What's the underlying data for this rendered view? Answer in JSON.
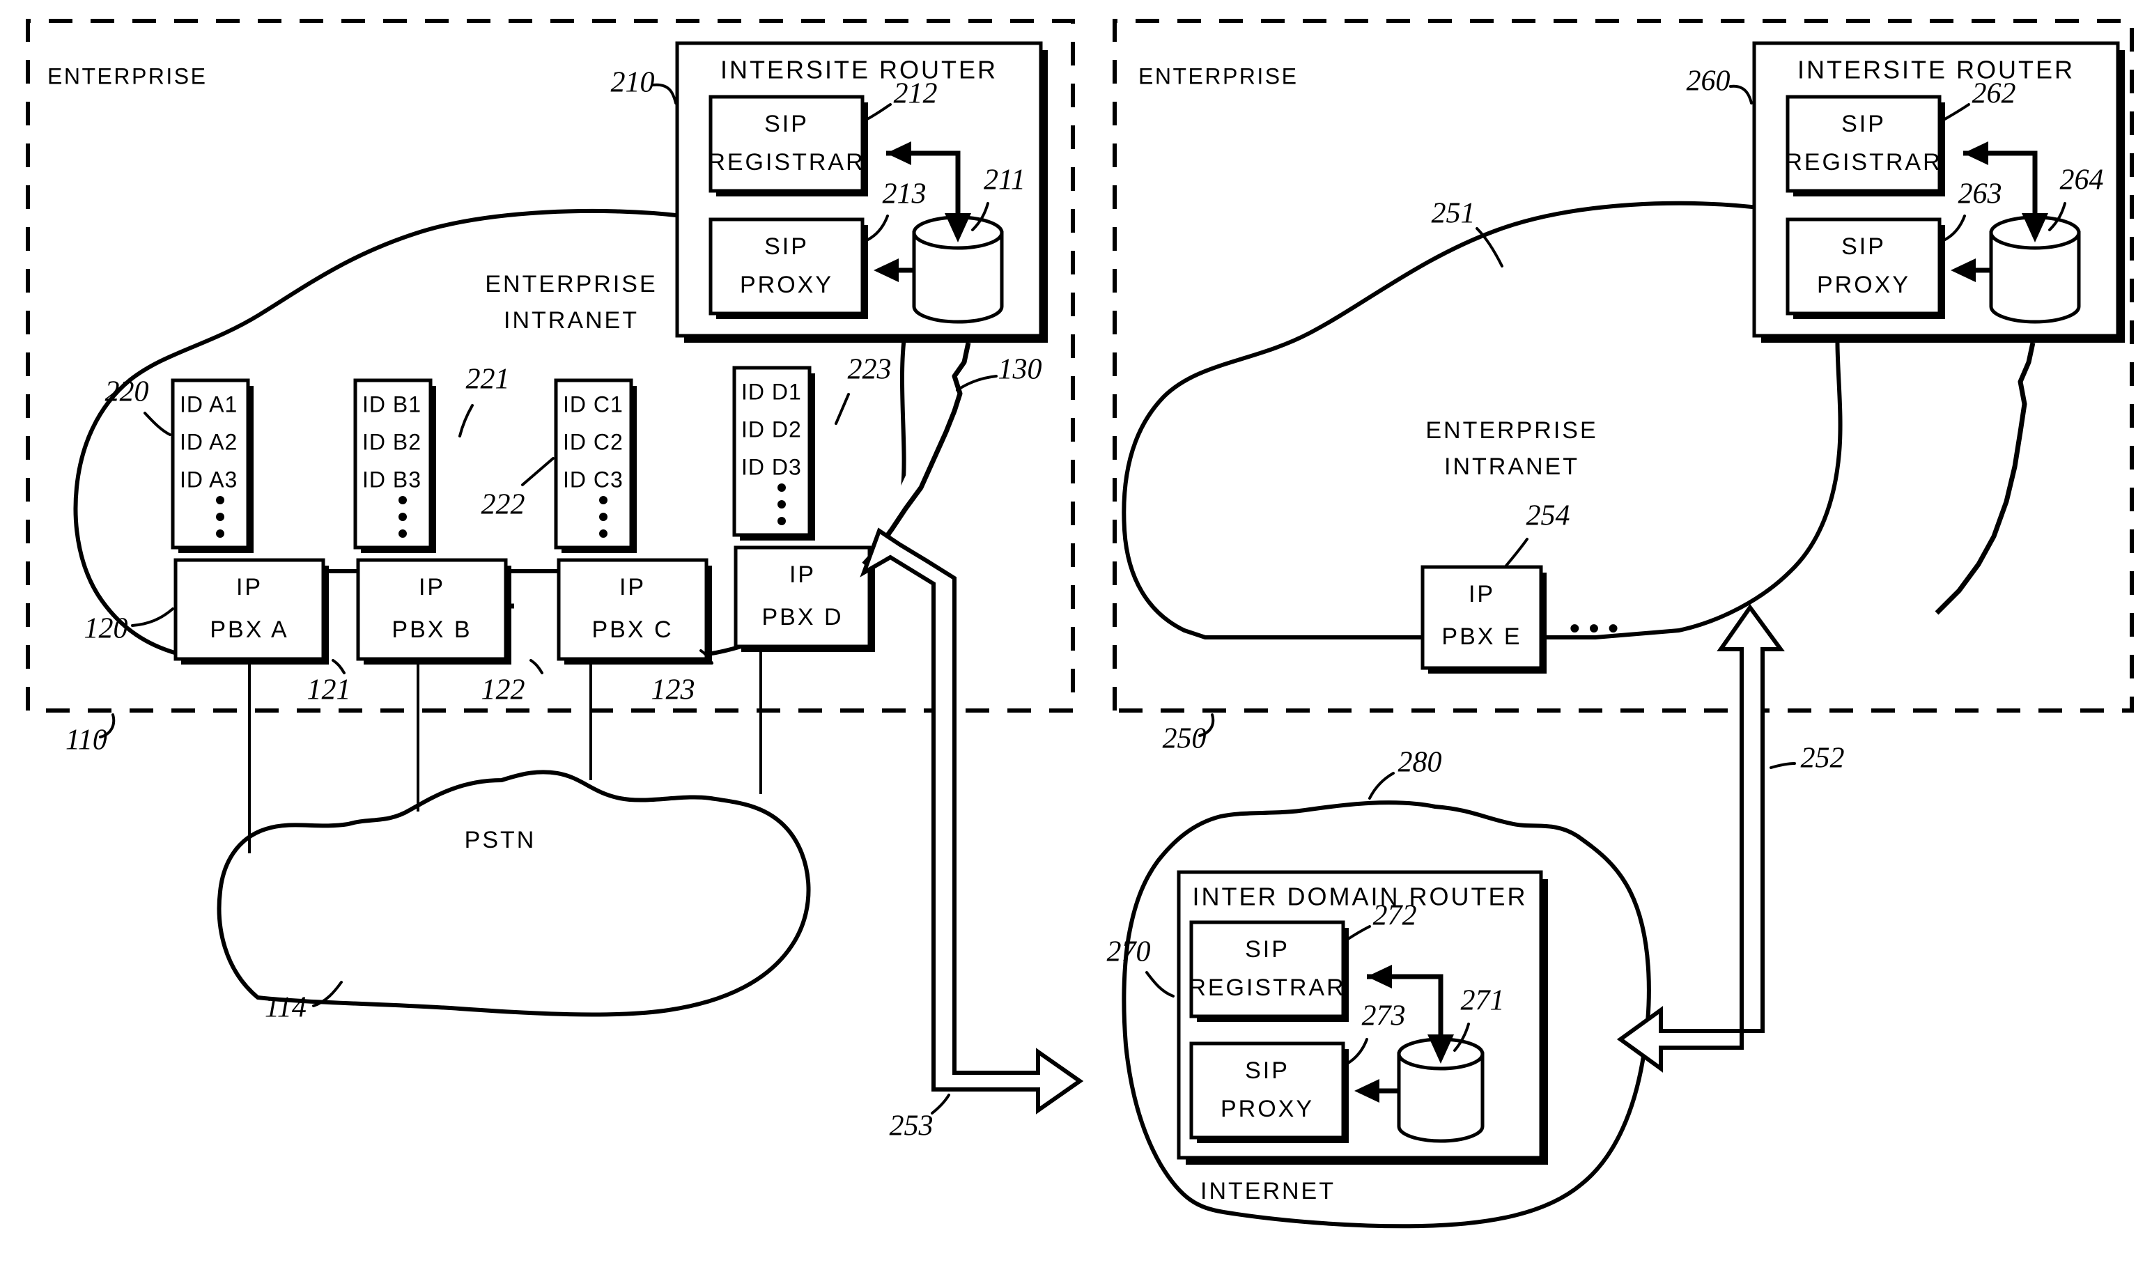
{
  "figure": {
    "left_region": {
      "label": "ENTERPRISE",
      "ref": "110"
    },
    "right_region": {
      "label": "ENTERPRISE",
      "ref": "250"
    },
    "left_router": {
      "title": "INTERSITE ROUTER",
      "ref": "210",
      "registrar": {
        "line1": "SIP",
        "line2": "REGISTRAR",
        "ref": "212"
      },
      "proxy": {
        "line1": "SIP",
        "line2": "PROXY",
        "ref": "213"
      },
      "database": {
        "ref": "211"
      }
    },
    "right_router": {
      "title": "INTERSITE ROUTER",
      "ref": "260",
      "registrar": {
        "line1": "SIP",
        "line2": "REGISTRAR",
        "ref": "262"
      },
      "proxy": {
        "line1": "SIP",
        "line2": "PROXY",
        "ref": "263"
      },
      "database": {
        "ref": "264"
      }
    },
    "inter_domain_router": {
      "title": "INTER DOMAIN ROUTER",
      "ref": "270",
      "registrar": {
        "line1": "SIP",
        "line2": "REGISTRAR",
        "ref": "272"
      },
      "proxy": {
        "line1": "SIP",
        "line2": "PROXY",
        "ref": "273"
      },
      "database": {
        "ref": "271"
      }
    },
    "left_cloud": {
      "line1": "ENTERPRISE",
      "line2": "INTRANET",
      "ref": "130"
    },
    "right_cloud": {
      "line1": "ENTERPRISE",
      "line2": "INTRANET",
      "ref": "251"
    },
    "pstn_cloud": {
      "label": "PSTN",
      "ref": "114"
    },
    "internet_cloud": {
      "label": "INTERNET",
      "ref": "280"
    },
    "id_tables": [
      {
        "ref": "220",
        "rows": [
          "ID  A1",
          "ID  A2",
          "ID  A3"
        ],
        "ellipsis": true
      },
      {
        "ref": "221",
        "rows": [
          "ID  B1",
          "ID  B2",
          "ID  B3"
        ],
        "ellipsis": true
      },
      {
        "ref": "222",
        "rows": [
          "ID  C1",
          "ID  C2",
          "ID  C3"
        ],
        "ellipsis": true
      },
      {
        "ref": "223",
        "rows": [
          "ID  D1",
          "ID  D2",
          "ID  D3"
        ],
        "ellipsis": true
      }
    ],
    "pbx_left": [
      {
        "ref": "120",
        "line1": "IP",
        "line2": "PBX  A"
      },
      {
        "ref": "121",
        "line1": "IP",
        "line2": "PBX  B"
      },
      {
        "ref": "122",
        "line1": "IP",
        "line2": "PBX  C"
      },
      {
        "ref": "123",
        "line1": "IP",
        "line2": "PBX  D"
      }
    ],
    "pbx_right": {
      "ref": "254",
      "line1": "IP",
      "line2": "PBX  E",
      "continuation": "• • •"
    },
    "tunnels": [
      {
        "ref": "253"
      },
      {
        "ref": "252"
      }
    ]
  }
}
